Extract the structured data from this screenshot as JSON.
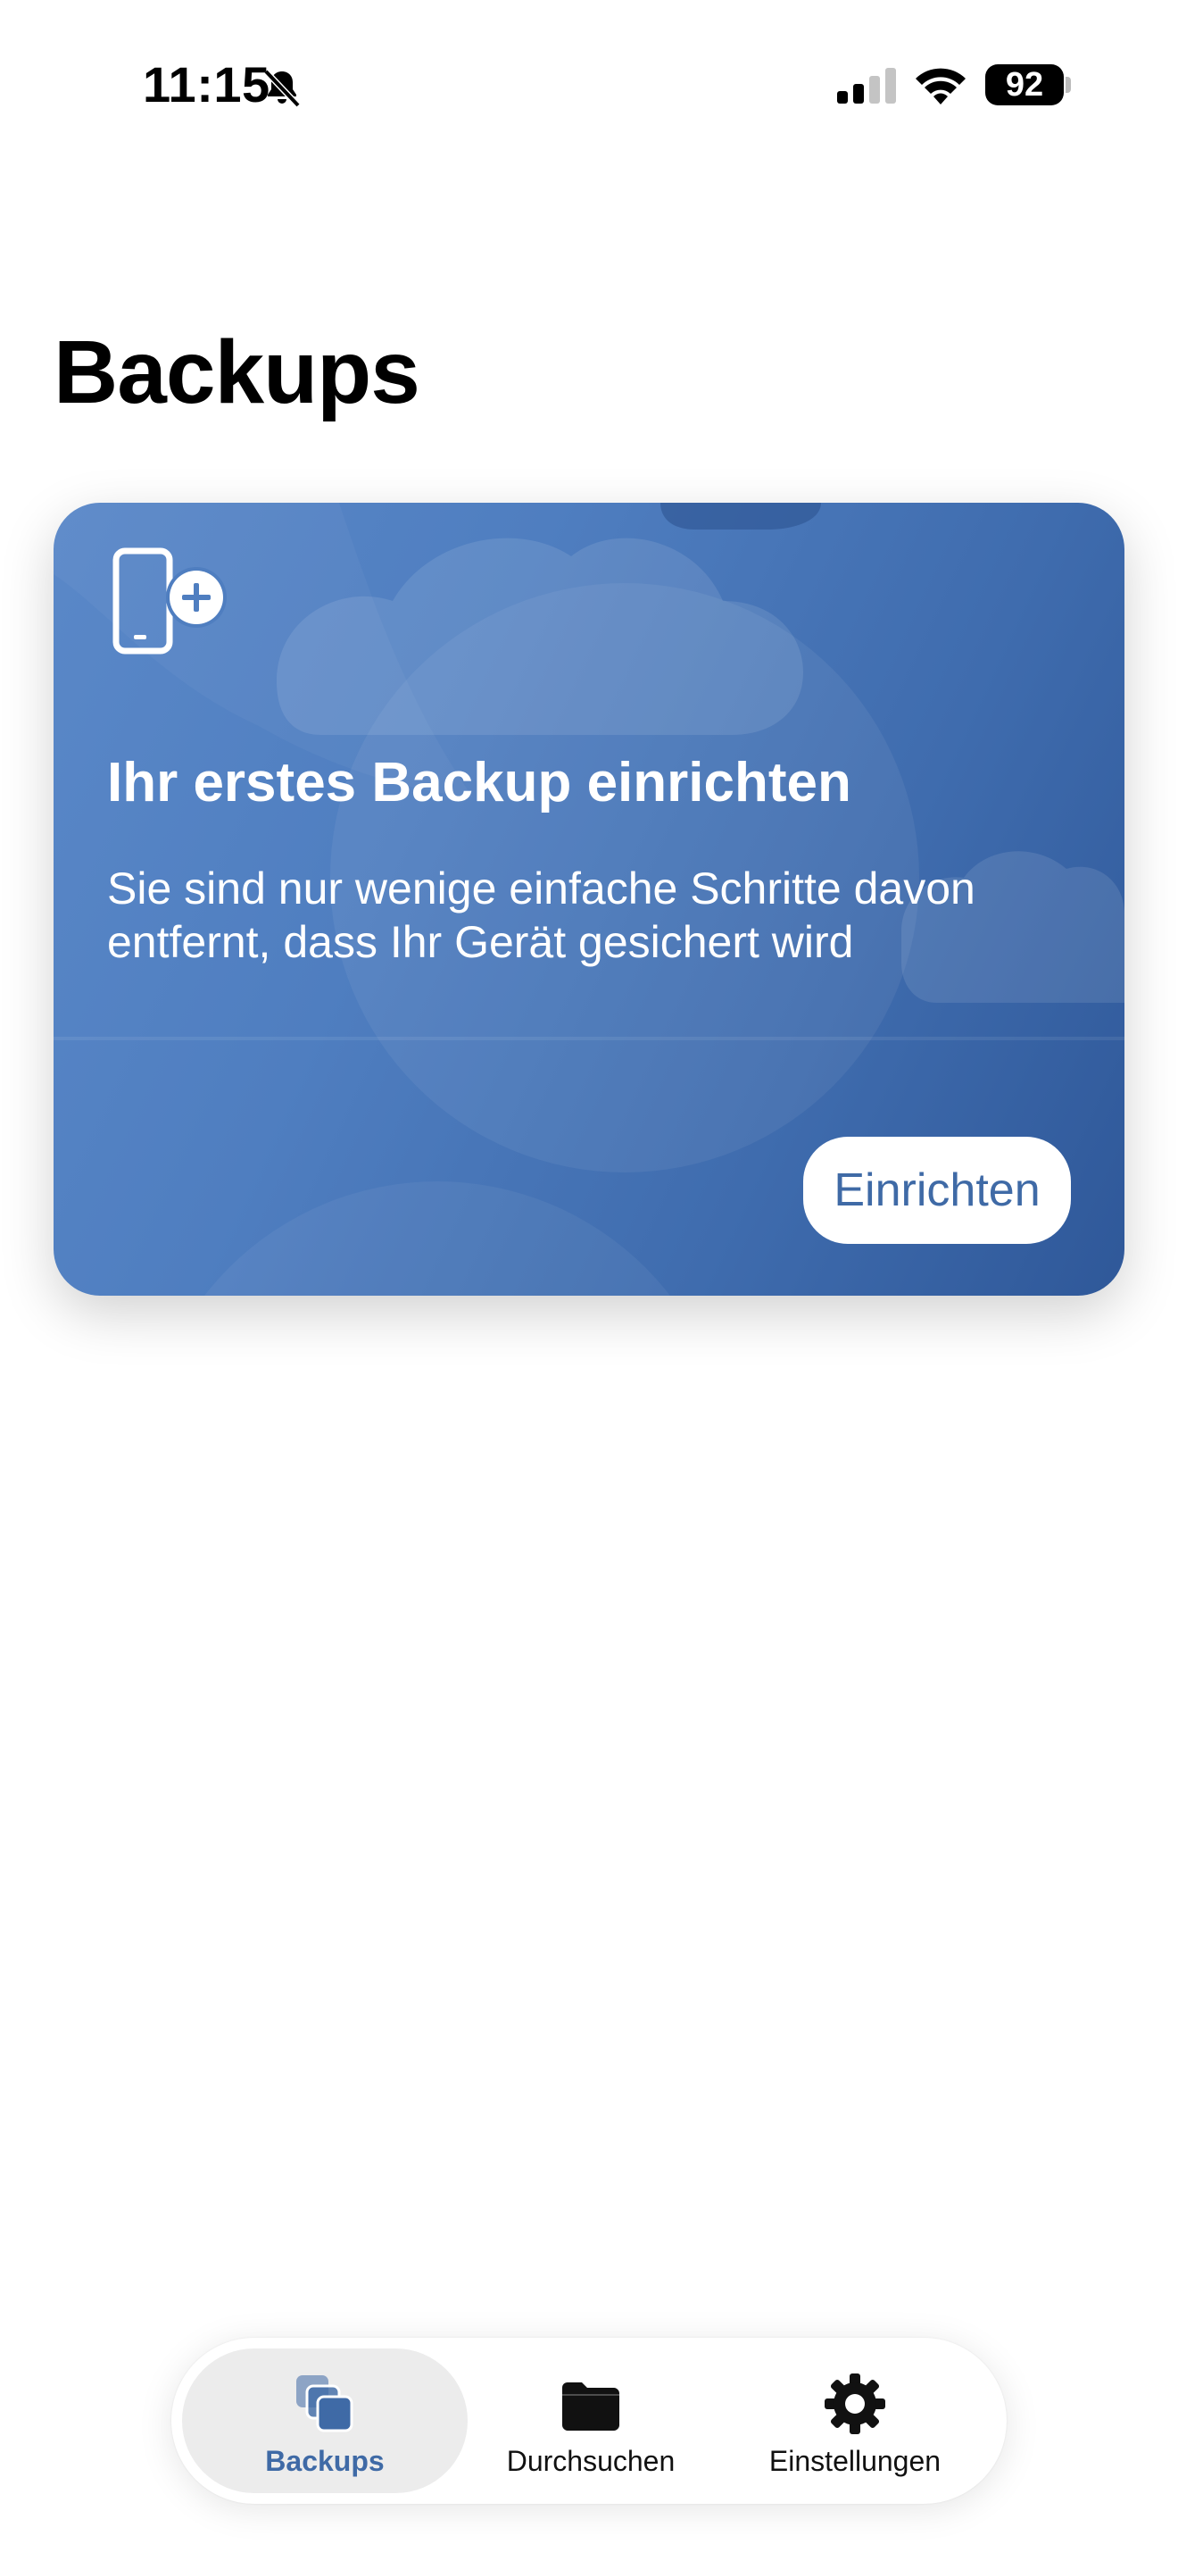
{
  "status_bar": {
    "time": "11:15",
    "battery": "92",
    "icons": [
      "bell-slash-icon",
      "cellular-signal-icon",
      "wifi-icon",
      "battery-icon"
    ]
  },
  "page": {
    "title": "Backups"
  },
  "card": {
    "icon": "phone-plus-icon",
    "title": "Ihr erstes Backup einrichten",
    "text": "Sie sind nur wenige einfache Schritte davon entfernt, dass Ihr Gerät gesichert wird",
    "button_label": "Einrichten",
    "colors": {
      "start": "#5a88c8",
      "end": "#2f5899",
      "button_text": "#3f6aa6"
    }
  },
  "tab_bar": {
    "tabs": [
      {
        "label": "Backups",
        "icon": "stacked-copies-icon",
        "active": true
      },
      {
        "label": "Durchsuchen",
        "icon": "folder-icon",
        "active": false
      },
      {
        "label": "Einstellungen",
        "icon": "gear-icon",
        "active": false
      }
    ],
    "accent": "#3f6aa6"
  }
}
